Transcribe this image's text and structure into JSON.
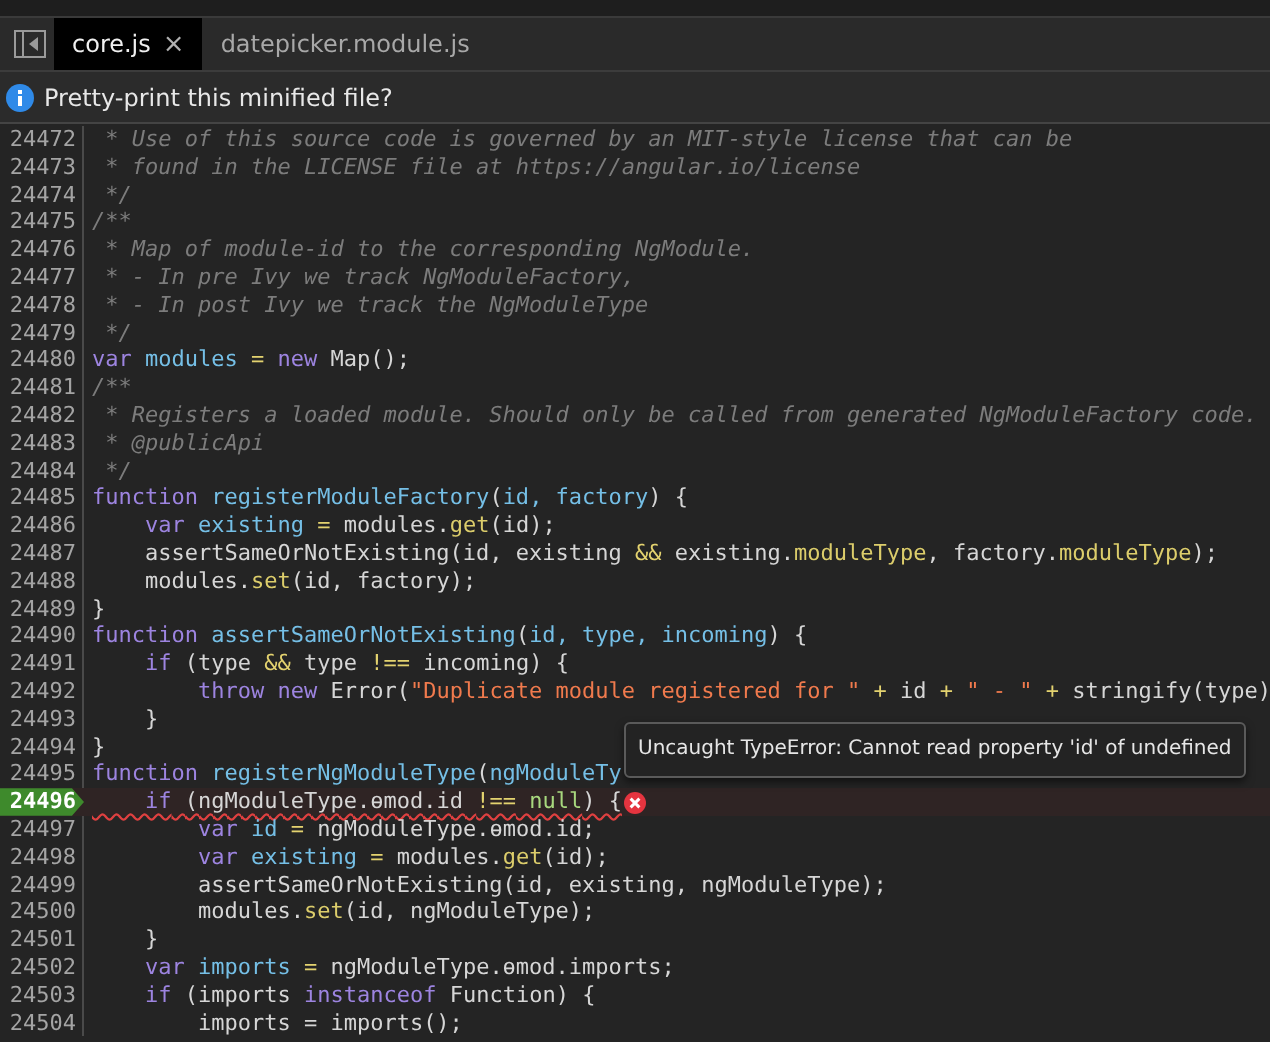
{
  "tabs": [
    {
      "label": "core.js",
      "selected": true,
      "close": "×"
    },
    {
      "label": "datepicker.module.js",
      "selected": false
    }
  ],
  "infobar": {
    "message": "Pretty-print this minified file?"
  },
  "lines": [
    {
      "number": "24472",
      "current": false,
      "error": false,
      "tokens": [
        {
          "kind": "com",
          "text": " * Use of this source code is governed by an MIT-style license that can be"
        }
      ]
    },
    {
      "number": "24473",
      "current": false,
      "error": false,
      "tokens": [
        {
          "kind": "com",
          "text": " * found in the LICENSE file at https://angular.io/license"
        }
      ]
    },
    {
      "number": "24474",
      "current": false,
      "error": false,
      "tokens": [
        {
          "kind": "com",
          "text": " */"
        }
      ]
    },
    {
      "number": "24475",
      "current": false,
      "error": false,
      "tokens": [
        {
          "kind": "com",
          "text": "/**"
        }
      ]
    },
    {
      "number": "24476",
      "current": false,
      "error": false,
      "tokens": [
        {
          "kind": "com",
          "text": " * Map of module-id to the corresponding NgModule."
        }
      ]
    },
    {
      "number": "24477",
      "current": false,
      "error": false,
      "tokens": [
        {
          "kind": "com",
          "text": " * - In pre Ivy we track NgModuleFactory,"
        }
      ]
    },
    {
      "number": "24478",
      "current": false,
      "error": false,
      "tokens": [
        {
          "kind": "com",
          "text": " * - In post Ivy we track the NgModuleType"
        }
      ]
    },
    {
      "number": "24479",
      "current": false,
      "error": false,
      "tokens": [
        {
          "kind": "com",
          "text": " */"
        }
      ]
    },
    {
      "number": "24480",
      "current": false,
      "error": false,
      "tokens": [
        {
          "kind": "kw",
          "text": "var"
        },
        {
          "kind": "def",
          "text": " modules"
        },
        {
          "kind": "op",
          "text": " = "
        },
        {
          "kind": "kw",
          "text": "new"
        },
        {
          "kind": "plain",
          "text": " Map();"
        }
      ]
    },
    {
      "number": "24481",
      "current": false,
      "error": false,
      "tokens": [
        {
          "kind": "com",
          "text": "/**"
        }
      ]
    },
    {
      "number": "24482",
      "current": false,
      "error": false,
      "tokens": [
        {
          "kind": "com",
          "text": " * Registers a loaded module. Should only be called from generated NgModuleFactory code."
        }
      ]
    },
    {
      "number": "24483",
      "current": false,
      "error": false,
      "tokens": [
        {
          "kind": "com",
          "text": " * @publicApi"
        }
      ]
    },
    {
      "number": "24484",
      "current": false,
      "error": false,
      "tokens": [
        {
          "kind": "com",
          "text": " */"
        }
      ]
    },
    {
      "number": "24485",
      "current": false,
      "error": false,
      "tokens": [
        {
          "kind": "kw",
          "text": "function"
        },
        {
          "kind": "def",
          "text": " registerModuleFactory"
        },
        {
          "kind": "plain",
          "text": "("
        },
        {
          "kind": "def",
          "text": "id"
        },
        {
          "kind": "def",
          "text": ", factory"
        },
        {
          "kind": "plain",
          "text": ") {"
        }
      ]
    },
    {
      "number": "24486",
      "current": false,
      "error": false,
      "tokens": [
        {
          "kind": "kw",
          "text": "    var"
        },
        {
          "kind": "def",
          "text": " existing"
        },
        {
          "kind": "op",
          "text": " = "
        },
        {
          "kind": "plain",
          "text": "modules."
        },
        {
          "kind": "prop",
          "text": "get"
        },
        {
          "kind": "plain",
          "text": "(id);"
        }
      ]
    },
    {
      "number": "24487",
      "current": false,
      "error": false,
      "tokens": [
        {
          "kind": "plain",
          "text": "    assertSameOrNotExisting(id, existing "
        },
        {
          "kind": "op",
          "text": "&&"
        },
        {
          "kind": "plain",
          "text": " existing."
        },
        {
          "kind": "prop",
          "text": "moduleType"
        },
        {
          "kind": "plain",
          "text": ", factory."
        },
        {
          "kind": "prop",
          "text": "moduleType"
        },
        {
          "kind": "plain",
          "text": ");"
        }
      ]
    },
    {
      "number": "24488",
      "current": false,
      "error": false,
      "tokens": [
        {
          "kind": "plain",
          "text": "    modules."
        },
        {
          "kind": "prop",
          "text": "set"
        },
        {
          "kind": "plain",
          "text": "(id, factory);"
        }
      ]
    },
    {
      "number": "24489",
      "current": false,
      "error": false,
      "tokens": [
        {
          "kind": "plain",
          "text": "}"
        }
      ]
    },
    {
      "number": "24490",
      "current": false,
      "error": false,
      "tokens": [
        {
          "kind": "kw",
          "text": "function"
        },
        {
          "kind": "def",
          "text": " assertSameOrNotExisting"
        },
        {
          "kind": "plain",
          "text": "("
        },
        {
          "kind": "def",
          "text": "id"
        },
        {
          "kind": "def",
          "text": ", type"
        },
        {
          "kind": "def",
          "text": ", incoming"
        },
        {
          "kind": "plain",
          "text": ") {"
        }
      ]
    },
    {
      "number": "24491",
      "current": false,
      "error": false,
      "tokens": [
        {
          "kind": "kw",
          "text": "    if"
        },
        {
          "kind": "plain",
          "text": " (type "
        },
        {
          "kind": "op",
          "text": "&&"
        },
        {
          "kind": "plain",
          "text": " type "
        },
        {
          "kind": "op",
          "text": "!=="
        },
        {
          "kind": "plain",
          "text": " incoming) {"
        }
      ]
    },
    {
      "number": "24492",
      "current": false,
      "error": false,
      "tokens": [
        {
          "kind": "kw",
          "text": "        throw"
        },
        {
          "kind": "kw",
          "text": " new"
        },
        {
          "kind": "plain",
          "text": " Error("
        },
        {
          "kind": "str",
          "text": "\"Duplicate module registered for \""
        },
        {
          "kind": "op",
          "text": " + "
        },
        {
          "kind": "plain",
          "text": "id"
        },
        {
          "kind": "op",
          "text": " + "
        },
        {
          "kind": "str",
          "text": "\" - \""
        },
        {
          "kind": "op",
          "text": " + "
        },
        {
          "kind": "plain",
          "text": "stringify(type)"
        }
      ]
    },
    {
      "number": "24493",
      "current": false,
      "error": false,
      "tokens": [
        {
          "kind": "plain",
          "text": "    }"
        }
      ]
    },
    {
      "number": "24494",
      "current": false,
      "error": false,
      "tokens": [
        {
          "kind": "plain",
          "text": "}"
        }
      ]
    },
    {
      "number": "24495",
      "current": false,
      "error": false,
      "tokens": [
        {
          "kind": "kw",
          "text": "function"
        },
        {
          "kind": "def",
          "text": " registerNgModuleType"
        },
        {
          "kind": "plain",
          "text": "("
        },
        {
          "kind": "def",
          "text": "ngModuleTy"
        }
      ]
    },
    {
      "number": "24496",
      "current": true,
      "error": true,
      "tokens": [
        {
          "kind": "kw",
          "text": "    if"
        },
        {
          "kind": "plain",
          "text": " (ngModuleType.ɵmod.id "
        },
        {
          "kind": "op",
          "text": "!=="
        },
        {
          "kind": "lit",
          "text": " null"
        },
        {
          "kind": "plain",
          "text": ") {"
        }
      ]
    },
    {
      "number": "24497",
      "current": false,
      "error": false,
      "tokens": [
        {
          "kind": "kw",
          "text": "        var"
        },
        {
          "kind": "def",
          "text": " id"
        },
        {
          "kind": "op",
          "text": " = "
        },
        {
          "kind": "plain",
          "text": "ngModuleType.ɵmod.id;"
        }
      ]
    },
    {
      "number": "24498",
      "current": false,
      "error": false,
      "tokens": [
        {
          "kind": "kw",
          "text": "        var"
        },
        {
          "kind": "def",
          "text": " existing"
        },
        {
          "kind": "op",
          "text": " = "
        },
        {
          "kind": "plain",
          "text": "modules."
        },
        {
          "kind": "prop",
          "text": "get"
        },
        {
          "kind": "plain",
          "text": "(id);"
        }
      ]
    },
    {
      "number": "24499",
      "current": false,
      "error": false,
      "tokens": [
        {
          "kind": "plain",
          "text": "        assertSameOrNotExisting(id, existing, ngModuleType);"
        }
      ]
    },
    {
      "number": "24500",
      "current": false,
      "error": false,
      "tokens": [
        {
          "kind": "plain",
          "text": "        modules."
        },
        {
          "kind": "prop",
          "text": "set"
        },
        {
          "kind": "plain",
          "text": "(id, ngModuleType);"
        }
      ]
    },
    {
      "number": "24501",
      "current": false,
      "error": false,
      "tokens": [
        {
          "kind": "plain",
          "text": "    }"
        }
      ]
    },
    {
      "number": "24502",
      "current": false,
      "error": false,
      "tokens": [
        {
          "kind": "kw",
          "text": "    var"
        },
        {
          "kind": "def",
          "text": " imports"
        },
        {
          "kind": "op",
          "text": " = "
        },
        {
          "kind": "plain",
          "text": "ngModuleType.ɵmod.imports;"
        }
      ]
    },
    {
      "number": "24503",
      "current": false,
      "error": false,
      "tokens": [
        {
          "kind": "kw",
          "text": "    if"
        },
        {
          "kind": "plain",
          "text": " (imports "
        },
        {
          "kind": "kw",
          "text": "instanceof"
        },
        {
          "kind": "plain",
          "text": " Function) {"
        }
      ]
    },
    {
      "number": "24504",
      "current": false,
      "error": false,
      "tokens": [
        {
          "kind": "plain",
          "text": "        imports = imports();"
        }
      ]
    }
  ],
  "tooltip": {
    "text": "Uncaught TypeError: Cannot read property 'id' of undefined"
  }
}
